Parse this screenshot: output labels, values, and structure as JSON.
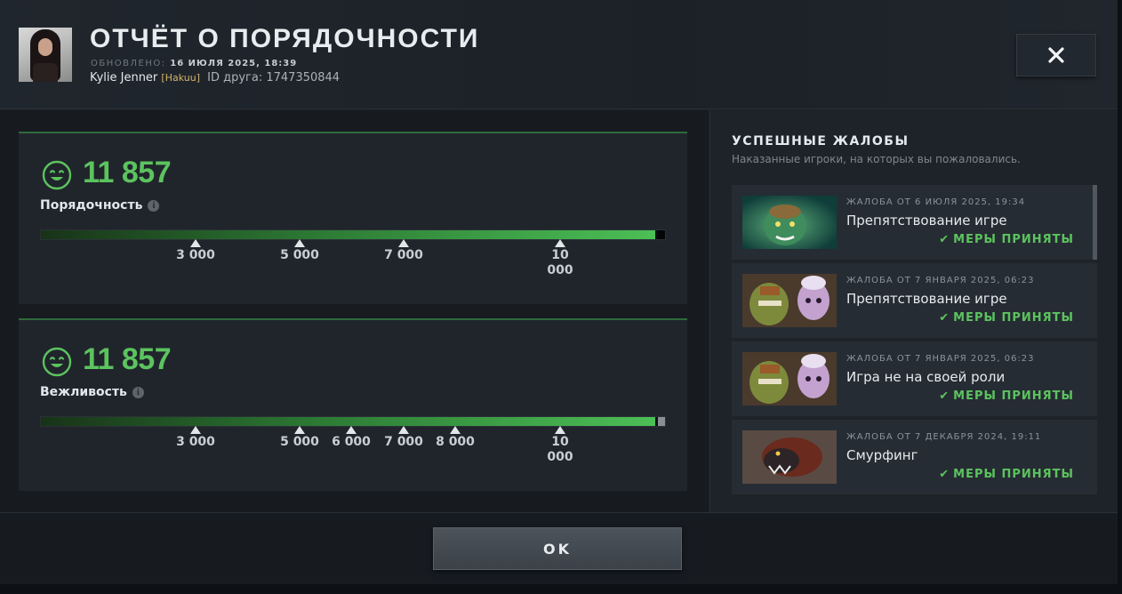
{
  "header": {
    "title": "ОТЧЁТ О ПОРЯДОЧНОСТИ",
    "updated_label": "ОБНОВЛЕНО:",
    "updated_value": "16 ИЮЛЯ 2025, 18:39",
    "user_name": "Kylie Jenner",
    "user_tag": "[Hakuu]",
    "friend_id": "ID друга: 1747350844",
    "close_icon": "close-icon"
  },
  "metrics": [
    {
      "score": "11 857",
      "label": "Порядочность",
      "fill_fraction": 0.985,
      "end_color": "#050607",
      "ticks": [
        "3 000",
        "5 000",
        "7 000",
        "10 000"
      ]
    },
    {
      "score": "11 857",
      "label": "Вежливость",
      "fill_fraction": 0.985,
      "end_color": "#8a8f93",
      "ticks": [
        "3 000",
        "5 000",
        "6 000",
        "7 000",
        "8 000",
        "10 000"
      ]
    }
  ],
  "reports_panel": {
    "title": "УСПЕШНЫЕ ЖАЛОБЫ",
    "subtitle": "Наказанные игроки, на которых вы пожаловались.",
    "items": [
      {
        "date": "ЖАЛОБА ОТ 6 ИЮЛЯ 2025, 19:34",
        "reason": "Препятствование игре",
        "status": "МЕРЫ ПРИНЯТЫ",
        "thumb": "green-hero-portrait"
      },
      {
        "date": "ЖАЛОБА ОТ 7 ЯНВАРЯ 2025, 06:23",
        "reason": "Препятствование игре",
        "status": "МЕРЫ ПРИНЯТЫ",
        "thumb": "orc-and-goblin-portrait"
      },
      {
        "date": "ЖАЛОБА ОТ 7 ЯНВАРЯ 2025, 06:23",
        "reason": "Игра не на своей роли",
        "status": "МЕРЫ ПРИНЯТЫ",
        "thumb": "orc-and-goblin-portrait"
      },
      {
        "date": "ЖАЛОБА ОТ 7 ДЕКАБРЯ 2024, 19:11",
        "reason": "Смурфинг",
        "status": "МЕРЫ ПРИНЯТЫ",
        "thumb": "beast-portrait"
      }
    ]
  },
  "footer": {
    "ok_label": "OK"
  },
  "colors": {
    "accent_green": "#5cc35f",
    "background": "#1b2026"
  }
}
